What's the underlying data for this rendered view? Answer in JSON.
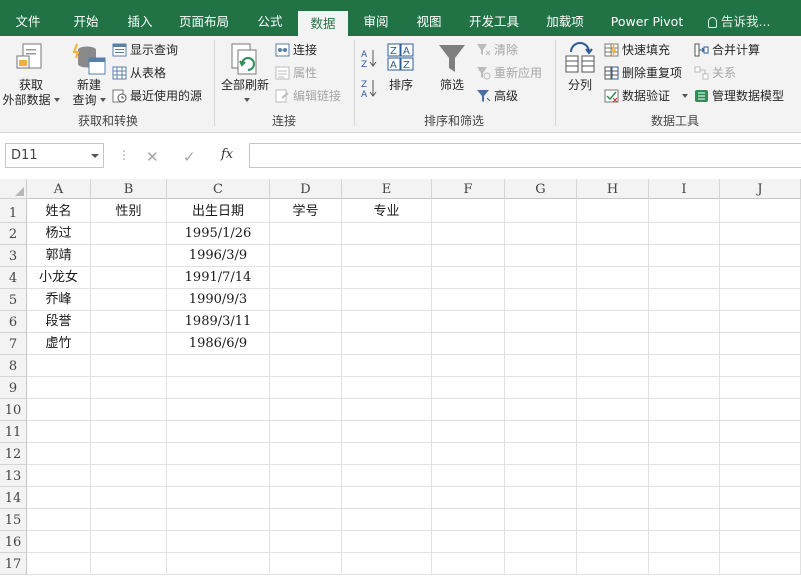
{
  "tabs": [
    {
      "label": "文件",
      "active": false
    },
    {
      "label": "开始",
      "active": false
    },
    {
      "label": "插入",
      "active": false
    },
    {
      "label": "页面布局",
      "active": false
    },
    {
      "label": "公式",
      "active": false
    },
    {
      "label": "数据",
      "active": true
    },
    {
      "label": "审阅",
      "active": false
    },
    {
      "label": "视图",
      "active": false
    },
    {
      "label": "开发工具",
      "active": false
    },
    {
      "label": "加载项",
      "active": false
    },
    {
      "label": "Power Pivot",
      "active": false
    }
  ],
  "tell_me": "告诉我...",
  "ribbon": {
    "get_transform": {
      "external_data_line1": "获取",
      "external_data_line2": "外部数据",
      "new_query_line1": "新建",
      "new_query_line2": "查询",
      "show_queries": "显示查询",
      "from_table": "从表格",
      "recent_sources": "最近使用的源",
      "label": "获取和转换"
    },
    "connections": {
      "refresh_all": "全部刷新",
      "connections": "连接",
      "properties": "属性",
      "edit_links": "编辑链接",
      "label": "连接"
    },
    "sort_filter": {
      "sort": "排序",
      "filter": "筛选",
      "clear": "清除",
      "reapply": "重新应用",
      "advanced": "高级",
      "label": "排序和筛选"
    },
    "data_tools": {
      "text_to_columns": "分列",
      "flash_fill": "快速填充",
      "remove_duplicates": "删除重复项",
      "data_validation": "数据验证",
      "consolidate": "合并计算",
      "relationships": "关系",
      "manage_data_model": "管理数据模型",
      "label": "数据工具"
    }
  },
  "formula_bar": {
    "name_box": "D11",
    "fx": "fx",
    "content": ""
  },
  "columns": [
    "A",
    "B",
    "C",
    "D",
    "E",
    "F",
    "G",
    "H",
    "I",
    "J"
  ],
  "rows": [
    "1",
    "2",
    "3",
    "4",
    "5",
    "6",
    "7",
    "8",
    "9",
    "10",
    "11",
    "12",
    "13",
    "14",
    "15",
    "16",
    "17"
  ],
  "cells": [
    [
      "姓名",
      "性别",
      "出生日期",
      "学号",
      "专业",
      "",
      "",
      "",
      "",
      ""
    ],
    [
      "杨过",
      "",
      "1995/1/26",
      "",
      "",
      "",
      "",
      "",
      "",
      ""
    ],
    [
      "郭靖",
      "",
      "1996/3/9",
      "",
      "",
      "",
      "",
      "",
      "",
      ""
    ],
    [
      "小龙女",
      "",
      "1991/7/14",
      "",
      "",
      "",
      "",
      "",
      "",
      ""
    ],
    [
      "乔峰",
      "",
      "1990/9/3",
      "",
      "",
      "",
      "",
      "",
      "",
      ""
    ],
    [
      "段誉",
      "",
      "1989/3/11",
      "",
      "",
      "",
      "",
      "",
      "",
      ""
    ],
    [
      "虚竹",
      "",
      "1986/6/9",
      "",
      "",
      "",
      "",
      "",
      "",
      ""
    ],
    [
      "",
      "",
      "",
      "",
      "",
      "",
      "",
      "",
      "",
      ""
    ],
    [
      "",
      "",
      "",
      "",
      "",
      "",
      "",
      "",
      "",
      ""
    ],
    [
      "",
      "",
      "",
      "",
      "",
      "",
      "",
      "",
      "",
      ""
    ],
    [
      "",
      "",
      "",
      "",
      "",
      "",
      "",
      "",
      "",
      ""
    ],
    [
      "",
      "",
      "",
      "",
      "",
      "",
      "",
      "",
      "",
      ""
    ],
    [
      "",
      "",
      "",
      "",
      "",
      "",
      "",
      "",
      "",
      ""
    ],
    [
      "",
      "",
      "",
      "",
      "",
      "",
      "",
      "",
      "",
      ""
    ],
    [
      "",
      "",
      "",
      "",
      "",
      "",
      "",
      "",
      "",
      ""
    ],
    [
      "",
      "",
      "",
      "",
      "",
      "",
      "",
      "",
      "",
      ""
    ],
    [
      "",
      "",
      "",
      "",
      "",
      "",
      "",
      "",
      "",
      ""
    ]
  ],
  "colors": {
    "accent": "#217346",
    "ribbon_bg": "#f3f3f3",
    "header_bg": "#f3f3f3",
    "gridline": "#e1e1e1"
  }
}
